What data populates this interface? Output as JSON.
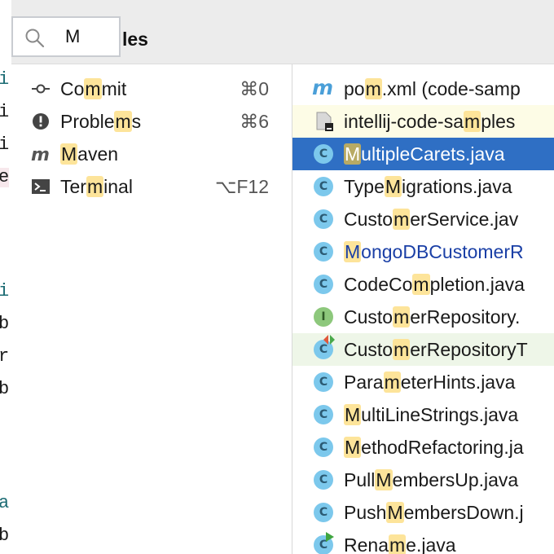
{
  "search": {
    "query": "M",
    "title_suffix": "les"
  },
  "editor_gutter": [
    "i",
    "i",
    "i",
    "e",
    "i",
    "b",
    "r",
    "b",
    "a",
    "b"
  ],
  "actions": [
    {
      "icon": "commit-icon",
      "pre": "Co",
      "hl": "m",
      "post": "mit",
      "shortcut": "⌘0"
    },
    {
      "icon": "problems-icon",
      "pre": "Proble",
      "hl": "m",
      "post": "s",
      "shortcut": "⌘6"
    },
    {
      "icon": "maven-icon",
      "pre": "",
      "hl": "M",
      "post": "aven",
      "shortcut": ""
    },
    {
      "icon": "terminal-icon",
      "pre": "Ter",
      "hl": "m",
      "post": "inal",
      "shortcut": "⌥F12"
    }
  ],
  "files": [
    {
      "icon": "maven-file-icon",
      "pre": "po",
      "hl": "m",
      "post": ".xml (code-samp",
      "state": "normal"
    },
    {
      "icon": "module-icon",
      "pre": "intellij-code-sa",
      "hl": "m",
      "post": "ples",
      "state": "hover"
    },
    {
      "icon": "class-icon",
      "pre": "",
      "hl": "M",
      "post": "ultipleCarets.java",
      "state": "selected"
    },
    {
      "icon": "class-icon",
      "pre": "Type",
      "hl": "M",
      "post": "igrations.java",
      "state": "normal"
    },
    {
      "icon": "class-icon",
      "pre": "Custo",
      "hl": "m",
      "post": "erService.jav",
      "state": "normal"
    },
    {
      "icon": "class-icon",
      "pre": "",
      "hl": "M",
      "post": "ongoDBCustomerR",
      "state": "modified"
    },
    {
      "icon": "class-icon",
      "pre": "CodeCo",
      "hl": "m",
      "post": "pletion.java",
      "state": "normal"
    },
    {
      "icon": "interface-icon",
      "pre": "Custo",
      "hl": "m",
      "post": "erRepository.",
      "state": "normal"
    },
    {
      "icon": "test-class-icon",
      "pre": "Custo",
      "hl": "m",
      "post": "erRepositoryT",
      "state": "test"
    },
    {
      "icon": "class-icon",
      "pre": "Para",
      "hl": "m",
      "post": "eterHints.java",
      "state": "normal"
    },
    {
      "icon": "class-icon",
      "pre": "",
      "hl": "M",
      "post": "ultiLineStrings.java",
      "state": "normal"
    },
    {
      "icon": "class-icon",
      "pre": "",
      "hl": "M",
      "post": "ethodRefactoring.ja",
      "state": "normal"
    },
    {
      "icon": "class-icon",
      "pre": "Pull",
      "hl": "M",
      "post": "embersUp.java",
      "state": "normal"
    },
    {
      "icon": "class-icon",
      "pre": "Push",
      "hl": "M",
      "post": "embersDown.j",
      "state": "normal"
    },
    {
      "icon": "runnable-class-icon",
      "pre": "Rena",
      "hl": "m",
      "post": "e.java",
      "state": "normal"
    }
  ],
  "colors": {
    "selection": "#2f6fc4",
    "hover_row": "#fdfce6",
    "test_row": "#eef6e8",
    "modified_text": "#1a3fa6",
    "match_highlight": "#fde49a"
  }
}
